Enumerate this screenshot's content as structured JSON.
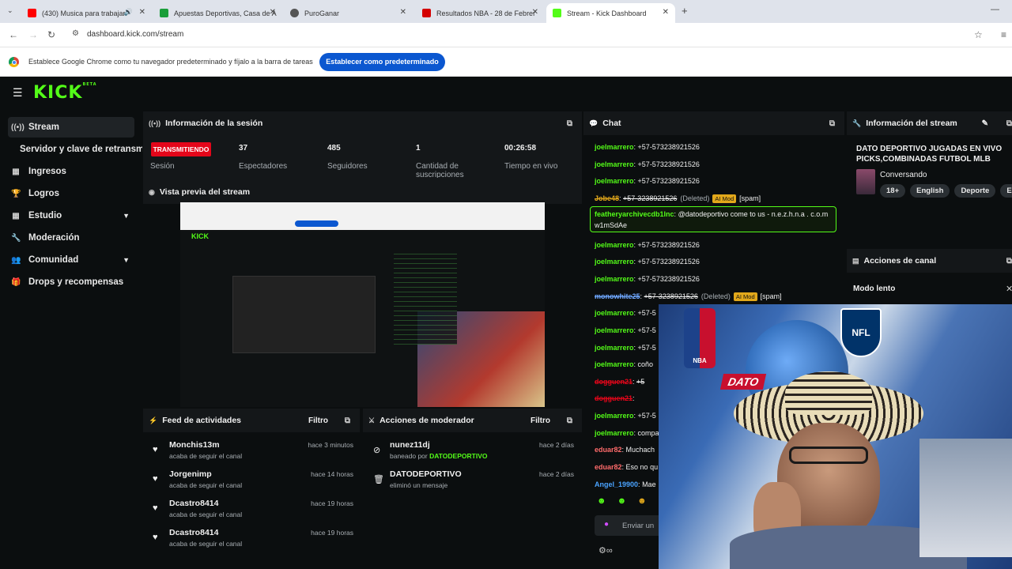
{
  "browser": {
    "tabs": [
      {
        "title": "(430) Musica para trabajar",
        "favicon_color": "#ff0000"
      },
      {
        "title": "Apuestas Deportivas, Casa de A",
        "favicon_color": "#1a9e3a"
      },
      {
        "title": "PuroGanar",
        "favicon_color": "#555555"
      },
      {
        "title": "Resultados NBA - 28 de Febrer",
        "favicon_color": "#d40000"
      },
      {
        "title": "Stream - Kick Dashboard",
        "favicon_color": "#53fc18"
      }
    ],
    "url": "dashboard.kick.com/stream",
    "infobar_message": "Establece Google Chrome como tu navegador predeterminado y fíjalo a la barra de tareas",
    "infobar_button": "Establecer como predeterminado"
  },
  "app": {
    "logo": "KICK",
    "logo_beta": "BETA",
    "accent": "#53fc18"
  },
  "sidebar": {
    "items": [
      {
        "label": "Stream",
        "icon": "broadcast-icon"
      },
      {
        "label": "Servidor y clave de retransm",
        "icon": ""
      },
      {
        "label": "Ingresos",
        "icon": "chart-icon"
      },
      {
        "label": "Logros",
        "icon": "trophy-icon"
      },
      {
        "label": "Estudio",
        "icon": "grid-icon"
      },
      {
        "label": "Moderación",
        "icon": "wrench-icon"
      },
      {
        "label": "Comunidad",
        "icon": "people-icon"
      },
      {
        "label": "Drops y recompensas",
        "icon": "gift-icon"
      }
    ]
  },
  "session": {
    "title": "Información de la sesión",
    "live_badge": "TRANSMITIENDO",
    "live_label": "Sesión",
    "stats": [
      {
        "value": "37",
        "label": "Espectadores"
      },
      {
        "value": "485",
        "label": "Seguidores"
      },
      {
        "value": "1",
        "label": "Cantidad de suscripciones"
      },
      {
        "value": "00:26:58",
        "label": "Tiempo en vivo"
      }
    ]
  },
  "preview": {
    "title": "Vista previa del stream"
  },
  "activity": {
    "title": "Feed de actividades",
    "filter": "Filtro",
    "items": [
      {
        "name": "Monchis13m",
        "action": "acaba de seguir el canal",
        "time": "hace 3 minutos"
      },
      {
        "name": "Jorgenimp",
        "action": "acaba de seguir el canal",
        "time": "hace 14 horas"
      },
      {
        "name": "Dcastro8414",
        "action": "acaba de seguir el canal",
        "time": "hace 19 horas"
      },
      {
        "name": "Dcastro8414",
        "action": "acaba de seguir el canal",
        "time": "hace 19 horas"
      }
    ]
  },
  "mod_actions": {
    "title": "Acciones de moderador",
    "filter": "Filtro",
    "items": [
      {
        "name": "nunez11dj",
        "action": "baneado por",
        "by": "DATODEPORTIVO",
        "time": "hace 2 días"
      },
      {
        "name": "DATODEPORTIVO",
        "action": "eliminó un mensaje",
        "by": "",
        "time": "hace 2 días"
      }
    ]
  },
  "chat": {
    "title": "Chat",
    "input_placeholder": "Enviar un",
    "messages": [
      {
        "user": "joelmarrero",
        "color": "#53fc18",
        "text": "+57-573238921526",
        "deleted": false
      },
      {
        "user": "joelmarrero",
        "color": "#53fc18",
        "text": "+57-573238921526",
        "deleted": false
      },
      {
        "user": "joelmarrero",
        "color": "#53fc18",
        "text": "+57-573238921526",
        "deleted": false
      },
      {
        "user": "Jobe48",
        "color": "#e2a81b",
        "text": "+57-3238921526",
        "deleted": true,
        "note": "(Deleted)",
        "mod": "AI Mod",
        "tag": "[spam]"
      },
      {
        "user": "joelmarrero",
        "color": "#53fc18",
        "text": "+57-573238921526",
        "deleted": false
      },
      {
        "user": "joelmarrero",
        "color": "#53fc18",
        "text": "+57-573238921526",
        "deleted": false
      },
      {
        "user": "joelmarrero",
        "color": "#53fc18",
        "text": "+57-573238921526",
        "deleted": false
      },
      {
        "user": "monowhite25",
        "color": "#6fa8ff",
        "text": "+57-3238921526",
        "deleted": true,
        "note": "(Deleted)",
        "mod": "AI Mod",
        "tag": "[spam]"
      },
      {
        "user": "joelmarrero",
        "color": "#53fc18",
        "text": "+57-5",
        "deleted": false
      },
      {
        "user": "joelmarrero",
        "color": "#53fc18",
        "text": "+57-5",
        "deleted": false
      },
      {
        "user": "joelmarrero",
        "color": "#53fc18",
        "text": "+57-5",
        "deleted": false
      },
      {
        "user": "joelmarrero",
        "color": "#53fc18",
        "text": "coño",
        "deleted": false
      },
      {
        "user": "dogguen21",
        "color": "#e4061a",
        "text": "+5",
        "deleted": true
      },
      {
        "user": "dogguen21",
        "color": "#e4061a",
        "text": "",
        "deleted": true
      },
      {
        "user": "joelmarrero",
        "color": "#53fc18",
        "text": "+57-5",
        "deleted": false
      },
      {
        "user": "joelmarrero",
        "color": "#53fc18",
        "text": "compa",
        "deleted": false
      },
      {
        "user": "eduar82",
        "color": "#ff6b6b",
        "text": "Muchach",
        "deleted": false
      },
      {
        "user": "eduar82",
        "color": "#ff6b6b",
        "text": "Eso no qu",
        "deleted": false
      },
      {
        "user": "Angel_19900",
        "color": "#4aa3ff",
        "text": "Mae",
        "deleted": false
      }
    ],
    "highlight": {
      "user": "featheryarchivecdb1lnc",
      "text": "@datodeportivo come to us - n.e.z.h.n.a . c.o.m w1mSdAe"
    }
  },
  "stream_info": {
    "title": "Información del stream",
    "stream_title": "DATO DEPORTIVO JUGADAS EN VIVO PICKS,COMBINADAS FUTBOL MLB",
    "category": "Conversando",
    "tags": [
      "18+",
      "English",
      "Deporte",
      "Espa"
    ]
  },
  "channel_actions": {
    "title": "Acciones de canal",
    "slow_mode": "Modo lento"
  },
  "webcam": {
    "overlay_text": "DATO",
    "nba": "NBA",
    "nfl": "NFL"
  }
}
